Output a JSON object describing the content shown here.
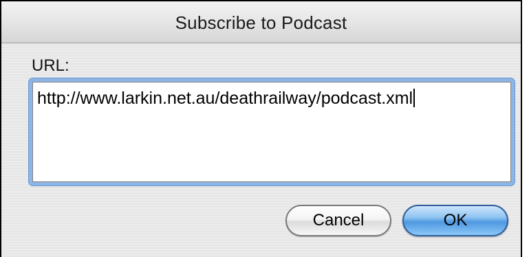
{
  "dialog": {
    "title": "Subscribe to Podcast",
    "url_label": "URL:",
    "url_value": "http://www.larkin.net.au/deathrailway/podcast.xml",
    "cancel_label": "Cancel",
    "ok_label": "OK"
  },
  "colors": {
    "focus_ring": "#8db6e6",
    "default_button": "#4f98e0"
  }
}
